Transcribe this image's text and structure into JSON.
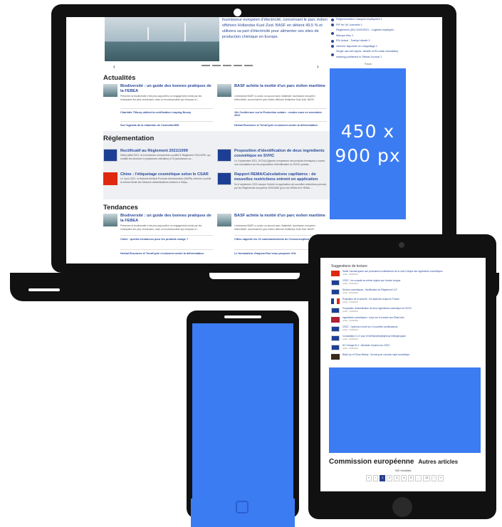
{
  "laptop": {
    "hero_text": "fournisseur européen d'électricité, concernant le parc éolien offshore Hollandse Kust Zuid. BASF en détient 49,5 % et utilisera sa part d'électricité pour alimenter ses sites de production chimique en Europe.",
    "prev_arrow": "‹",
    "next_arrow": "›",
    "sidebar_links": [
      "Réglementation marques impliquées 1",
      "PIF for UK cosmetic 1",
      "Règlement (UE) 2020/2021 - Logistes impliqués - Marque étoc 1",
      "EN-Actual - Toathpl cilsate 2",
      "cherche fajoumier en maquillage 1",
      "Single use wet wipes: details of EU-wide mandatory marking published in Official Journal 1"
    ],
    "ad_caption": "Forum",
    "ad_size_line1": "450 x",
    "ad_size_line2": "900 px",
    "actualites": {
      "title": "Actualités",
      "card1_title": "Biodiversité : un guide des bonnes pratiques de la FEBEA",
      "card1_body": "Préserver la biodiversité n'est plus aujourd'hui un engagement choisi par les entreprises les plus vertueuses, mais un incontournable qui s'impose à l...",
      "card2_title": "BASF achète la moitié d'un parc éolien maritime",
      "card2_body": "L'entreprise BASF a conclu un accord avec Vattenfall, fournisseur européen d'électricité, concernant le parc éolien offshore Hollandse Kust Zuid. BASF...",
      "link1": "Charlotte Tilbury obtient la certification Leaping Bunny",
      "link2": "10e Conférence sur la Protection solaire : rendez-vous en novembre 2021",
      "link3": "Sur l'agenda de la rédaction de CosmeticOBS",
      "link4": "Herbal Essences et TerraCycle s'unissent contre la déforestation"
    },
    "reglementation": {
      "title": "Réglementation",
      "card1_title": "Rectificatif au Règlement 2021/1099",
      "card1_body": "Début juillet 2021, la Commission européenne a publié le Règlement 2021/1099, qui modifie les Annexes II (substances interdites) et III (substances so...",
      "card2_title": "Proposition d'identification de deux ingrédients cosmétique en SVHC",
      "card2_body": "Le 3 septembre 2021, l'ECHA (Agence européenne des produits chimiques) a ouvert une consultation sur les propositions d'identification en SVHC (substa...",
      "card3_title": "Chine : l'étiquetage cosmétique selon le CSAR",
      "card3_body": "Le 3 juin 2021, la National Medical Products Administration (NMPA) chinoise a publié la version finale des Mesures administratives relatives à l'étiqu...",
      "card4_title": "Rapport REMA/Calculations capillaires : de nouvelles restrictions entrent en application",
      "card4_body": "Du 6 septembre 2021 marque l'entrée en application de nouvelles restrictions prévues par les Règlements européens 2020/1682 (pour les HEMA et le HEMA ..."
    },
    "tendances": {
      "title": "Tendances",
      "card1_title": "Biodiversité : un guide des bonnes pratiques de la FEBEA",
      "card1_body": "Préserver la biodiversité n'est plus aujourd'hui un engagement choisi par les entreprises les plus vertueuses, mais un incontournable qui s'impose à l...",
      "card2_title": "BASF achète la moitié d'un parc éolien maritime",
      "card2_body": "L'entreprise BASF a conclu un accord avec Vattenfall, fournisseur européen d'électricité, concernant le parc éolien offshore Hollandse Kust Zuid. BASF...",
      "link1": "Chine : quelles tendances pour les produits visage ?",
      "link2": "Cities rappelle les 10 commandements de l'écoconception",
      "link3": "Herbal Essences et TerraCycle s'unissent contre la déforestation",
      "link4": "Le formulateur d'aujourd'hui vous proposer XXL"
    }
  },
  "tablet": {
    "suggestions_title": "Suggestions de lecture",
    "items": [
      {
        "text": "Santé Canada ajoute aux prochaines modifications de la Liste Critique des ingrédients cosmétiques",
        "date": "publié : 28/08/2021"
      },
      {
        "text": "CSSC : les conseils au même régime que l'année lorsque",
        "date": "publié : 28/11/2021"
      },
      {
        "text": "Dioxins cosmétiques : Modification du Règlement CLP",
        "date": "publié : 28/10/2021"
      },
      {
        "text": "Évaluation de la sécurité : les diplômes requis en France",
        "date": "publié : 07/04/2021"
      },
      {
        "text": "Proposition d'identification de deux ingrédients cosmétique en SVHC",
        "date": "publié : 14/09/2021"
      },
      {
        "text": "Ingrédients cosmétiques : focus sur le marché aux États-Unis",
        "date": "publié : 16/09/2018"
      },
      {
        "text": "CSSC : Opinions à venir sur 2 nouvelles combinaisons",
        "date": "publié : 12/09/2021"
      },
      {
        "text": "Consultation CI-V pour le Methylmethyldiphenyl triethylpropylal",
        "date": "publié : 20/08/2021"
      },
      {
        "text": "NC Orange fin 4 : demande d'opinion au CSSC",
        "date": "publié : 16/06/2021"
      },
      {
        "text": "Black Lip et Clean Beauty : Sourcing du nouveau sujet cosmétique",
        "date": ""
      }
    ],
    "heading": "Commission européenne",
    "heading_sub": "Autres articles",
    "results": "300 résultats",
    "pager": [
      "«",
      "‹",
      "1",
      "2",
      "3",
      "4",
      "5",
      "...",
      "13",
      "›",
      "»"
    ]
  },
  "colors": {
    "ad_blue": "#3c7cf2",
    "link_blue": "#2a4a9a",
    "device": "#111111"
  }
}
